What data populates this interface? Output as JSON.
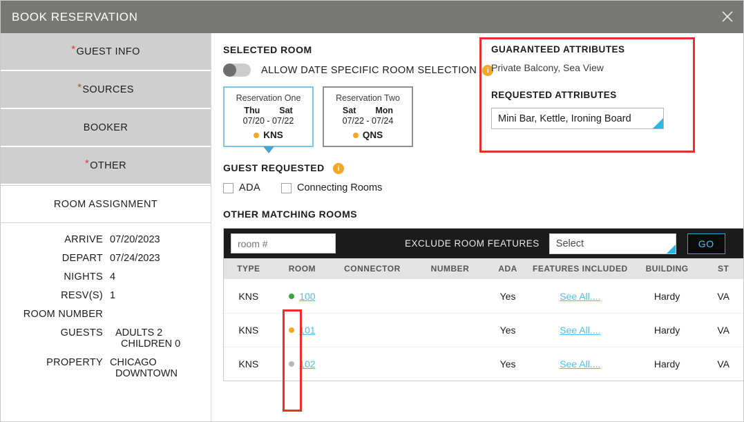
{
  "window": {
    "title": "BOOK RESERVATION",
    "close_icon": "close-icon"
  },
  "sidebar": {
    "tabs": [
      {
        "label": "GUEST INFO",
        "required": true,
        "active": false
      },
      {
        "label": "SOURCES",
        "required": true,
        "active": false
      },
      {
        "label": "BOOKER",
        "required": false,
        "active": false
      },
      {
        "label": "OTHER",
        "required": true,
        "active": false
      },
      {
        "label": "ROOM ASSIGNMENT",
        "required": false,
        "active": true
      }
    ],
    "details": [
      {
        "label": "ARRIVE",
        "value": "07/20/2023"
      },
      {
        "label": "DEPART",
        "value": "07/24/2023"
      },
      {
        "label": "NIGHTS",
        "value": "4"
      },
      {
        "label": "RESV(S)",
        "value": "1"
      },
      {
        "label": "ROOM NUMBER",
        "value": ""
      },
      {
        "label": "GUESTS",
        "value": "ADULTS 2",
        "value2": "CHILDREN 0"
      },
      {
        "label": "PROPERTY",
        "value": "CHICAGO",
        "value2": "DOWNTOWN"
      }
    ]
  },
  "selected_room": {
    "title": "SELECTED ROOM",
    "toggle": {
      "label": "ALLOW DATE SPECIFIC ROOM SELECTION",
      "state": "off",
      "info_icon": "info-icon"
    },
    "cards": [
      {
        "name": "Reservation One",
        "dow_start": "Thu",
        "dow_end": "Sat",
        "dates": "07/20 - 07/22",
        "room_type": "KNS",
        "dot_color": "#f5a623",
        "selected": true
      },
      {
        "name": "Reservation Two",
        "dow_start": "Sat",
        "dow_end": "Mon",
        "dates": "07/22 - 07/24",
        "room_type": "QNS",
        "dot_color": "#f5a623",
        "selected": false
      }
    ]
  },
  "attributes": {
    "guaranteed_title": "GUARANTEED ATTRIBUTES",
    "guaranteed_value": "Private Balcony, Sea View",
    "requested_title": "REQUESTED ATTRIBUTES",
    "requested_value": "Mini Bar, Kettle, Ironing Board",
    "highlight_color": "#e8302a"
  },
  "guest_requested": {
    "title": "GUEST REQUESTED",
    "info_icon": "info-icon",
    "checkboxes": [
      {
        "label": "ADA",
        "checked": false
      },
      {
        "label": "Connecting Rooms",
        "checked": false
      }
    ]
  },
  "other_matching_rooms": {
    "title": "OTHER MATCHING ROOMS",
    "room_number_placeholder": "room #",
    "room_number_value": "",
    "exclude_label": "EXCLUDE ROOM FEATURES",
    "exclude_select_value": "Select",
    "go_label": "GO",
    "columns": [
      "TYPE",
      "ROOM",
      "CONNECTOR",
      "NUMBER",
      "ADA",
      "FEATURES INCLUDED",
      "BUILDING",
      "ST"
    ],
    "rows": [
      {
        "type": "KNS",
        "dot_color": "#3aa33a",
        "room": "100",
        "connector": "",
        "number": "",
        "ada": "Yes",
        "features": "See All....",
        "building": "Hardy",
        "status": "VA"
      },
      {
        "type": "KNS",
        "dot_color": "#f5a623",
        "room": "101",
        "connector": "",
        "number": "",
        "ada": "Yes",
        "features": "See All....",
        "building": "Hardy",
        "status": "VA"
      },
      {
        "type": "KNS",
        "dot_color": "#b7b7b7",
        "room": "102",
        "connector": "",
        "number": "",
        "ada": "Yes",
        "features": "See All....",
        "building": "Hardy",
        "status": "VA"
      }
    ]
  },
  "colors": {
    "titlebar": "#777776",
    "tab_inactive": "#cfcfcf",
    "accent_link": "#4fc0e8",
    "accent_cyan": "#29b6e8",
    "annotation_red": "#e8302a",
    "info_amber": "#f5a623"
  }
}
